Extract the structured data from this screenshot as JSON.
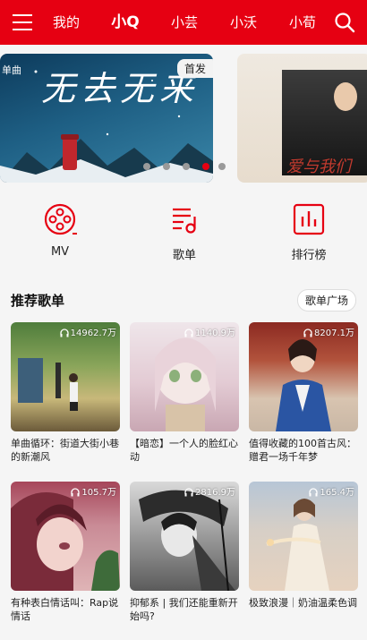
{
  "header": {
    "tabs": [
      "我的",
      "小Q",
      "小芸",
      "小沃",
      "小荀"
    ],
    "active_tab": "小Q"
  },
  "banner": {
    "badge": "首发",
    "subtitle": "单曲",
    "title_script": "无去无来",
    "second_title": "爱与我们"
  },
  "quick_nav": [
    {
      "label": "MV",
      "icon": "film-reel-icon"
    },
    {
      "label": "歌单",
      "icon": "playlist-note-icon"
    },
    {
      "label": "排行榜",
      "icon": "bar-chart-icon"
    }
  ],
  "recommend": {
    "title": "推荐歌单",
    "more_label": "歌单广场",
    "playlists": [
      {
        "count": "14962.7万",
        "title": "单曲循环：街道大街小巷的新潮风"
      },
      {
        "count": "1140.9万",
        "title": "【暗恋】一个人的脸红心动"
      },
      {
        "count": "8207.1万",
        "title": "值得收藏的100首古风：赠君一场千年梦"
      },
      {
        "count": "105.7万",
        "title": "有种表白情话叫：Rap说情话"
      },
      {
        "count": "2816.9万",
        "title": "抑郁系 | 我们还能重新开始吗?"
      },
      {
        "count": "165.4万",
        "title": "极致浪漫｜奶油温柔色调"
      }
    ]
  },
  "colors": {
    "accent": "#e60012"
  }
}
